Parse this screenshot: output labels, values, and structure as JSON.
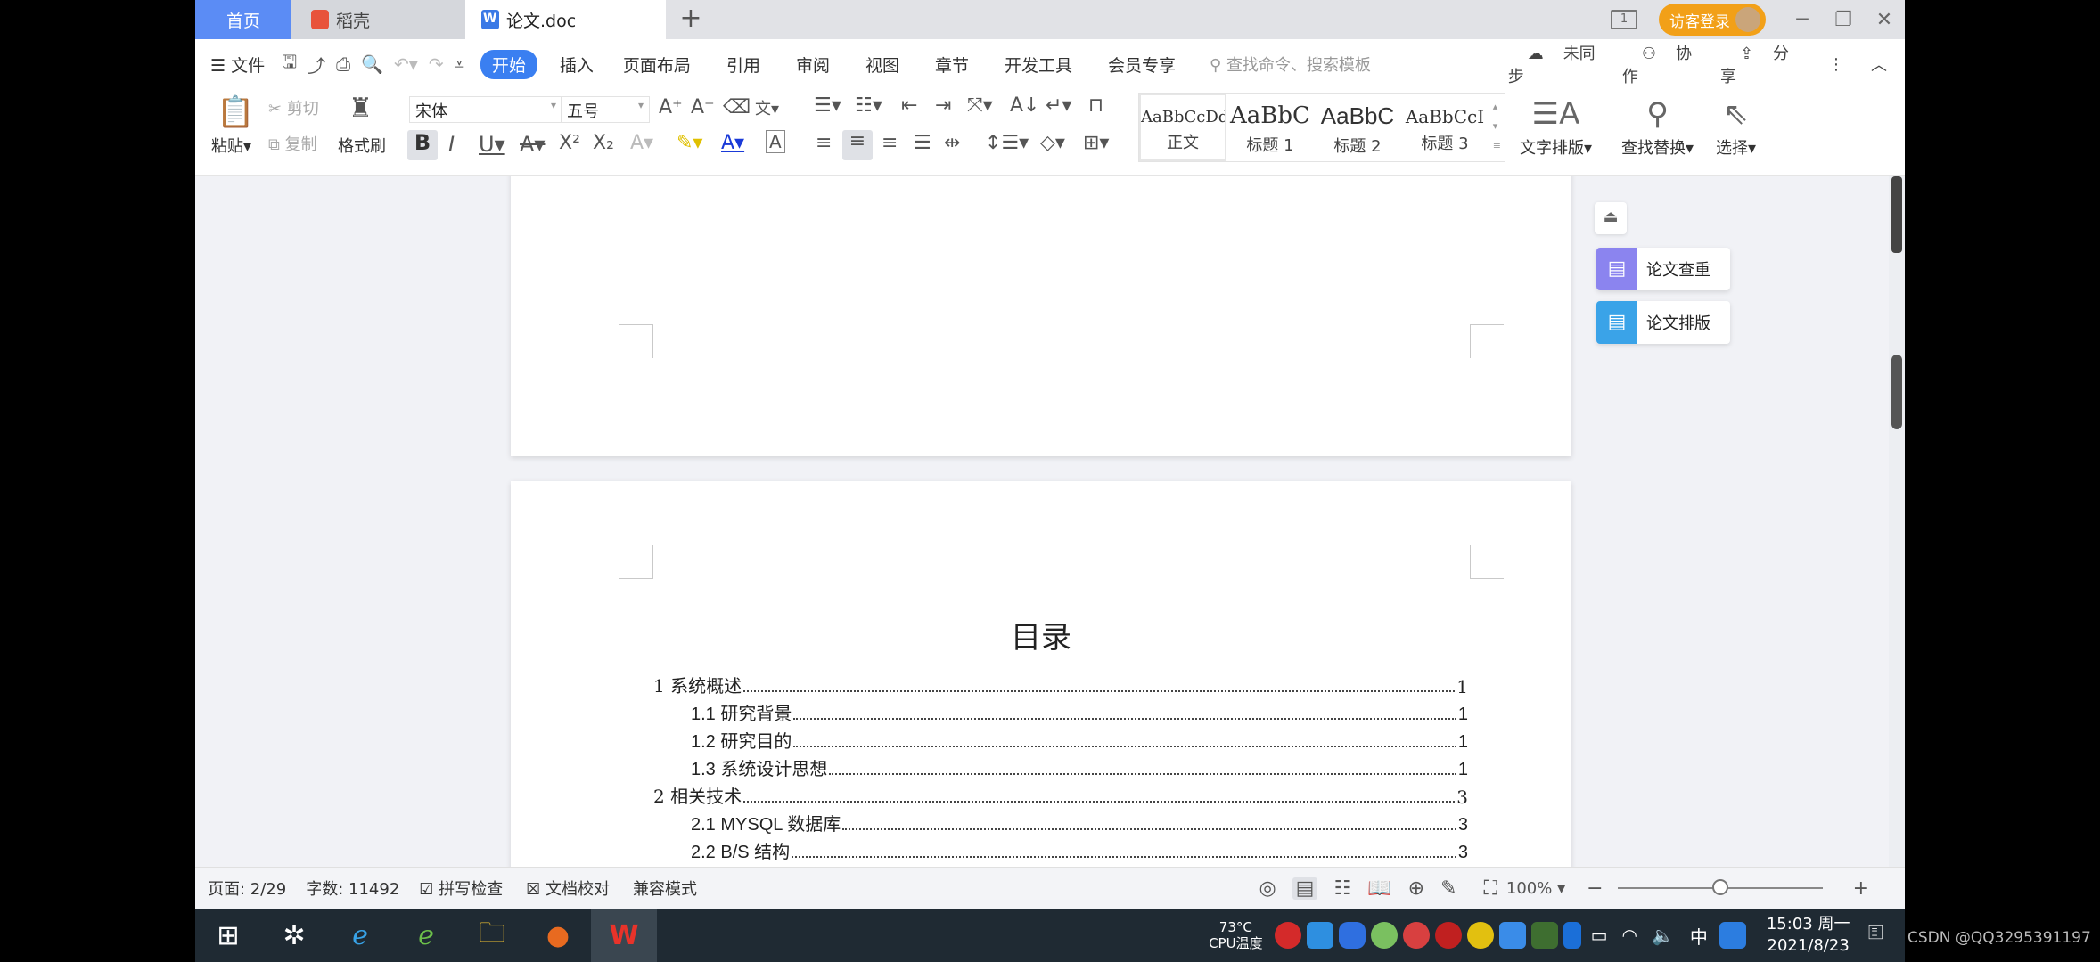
{
  "tabs": {
    "home": "首页",
    "daoke": "稻壳",
    "doc": "论文.doc",
    "new_tab": "+"
  },
  "titlebar": {
    "page_count_icon": "1",
    "visitor_login": "访客登录",
    "minimize": "─",
    "restore": "❐",
    "close": "✕"
  },
  "menu": {
    "file": "文件",
    "items": [
      "开始",
      "插入",
      "页面布局",
      "引用",
      "审阅",
      "视图",
      "章节",
      "开发工具",
      "会员专享"
    ],
    "active": "开始",
    "search_placeholder": "查找命令、搜索模板",
    "sync": "未同步",
    "collab": "协作",
    "share": "分享"
  },
  "ribbon": {
    "paste": "粘贴",
    "cut": "剪切",
    "copy": "复制",
    "format_painter": "格式刷",
    "font_name": "宋体",
    "font_size": "五号",
    "styles": [
      {
        "preview": "AaBbCcDd",
        "label": "正文"
      },
      {
        "preview": "AaBbC",
        "label": "标题 1"
      },
      {
        "preview": "AaBbC",
        "label": "标题 2"
      },
      {
        "preview": "AaBbCcI",
        "label": "标题 3"
      }
    ],
    "text_layout": "文字排版",
    "find_replace": "查找替换",
    "select": "选择"
  },
  "side_panel": {
    "plagiarism_check": "论文查重",
    "thesis_layout": "论文排版",
    "colors": {
      "plagiarism": "#8b84ef",
      "layout": "#3aa3e8"
    }
  },
  "document": {
    "toc_title": "目录",
    "toc": [
      {
        "level": 1,
        "text": "1 系统概述",
        "page": "1"
      },
      {
        "level": 2,
        "text": "1.1  研究背景",
        "page": "1"
      },
      {
        "level": 2,
        "text": "1.2 研究目的",
        "page": "1"
      },
      {
        "level": 2,
        "text": "1.3 系统设计思想",
        "page": "1"
      },
      {
        "level": 1,
        "text": "2 相关技术",
        "page": "3"
      },
      {
        "level": 2,
        "text": "2.1 MYSQL 数据库",
        "page": "3"
      },
      {
        "level": 2,
        "text": "2.2 B/S 结构",
        "page": "3"
      }
    ]
  },
  "status": {
    "page": "页面: 2/29",
    "words": "字数: 11492",
    "spell_check": "拼写检查",
    "doc_proof": "文档校对",
    "compat_mode": "兼容模式",
    "zoom": "100%",
    "zoom_level": 0.5
  },
  "taskbar": {
    "cpu_temp": "73°C",
    "cpu_label": "CPU温度",
    "ime": "中",
    "time": "15:03 周一",
    "date": "2021/8/23"
  },
  "watermark": "CSDN @QQ3295391197",
  "colors": {
    "accent": "#3a7ff1",
    "home_tab": "#5b8cf5",
    "visitor": "#f2a018"
  }
}
